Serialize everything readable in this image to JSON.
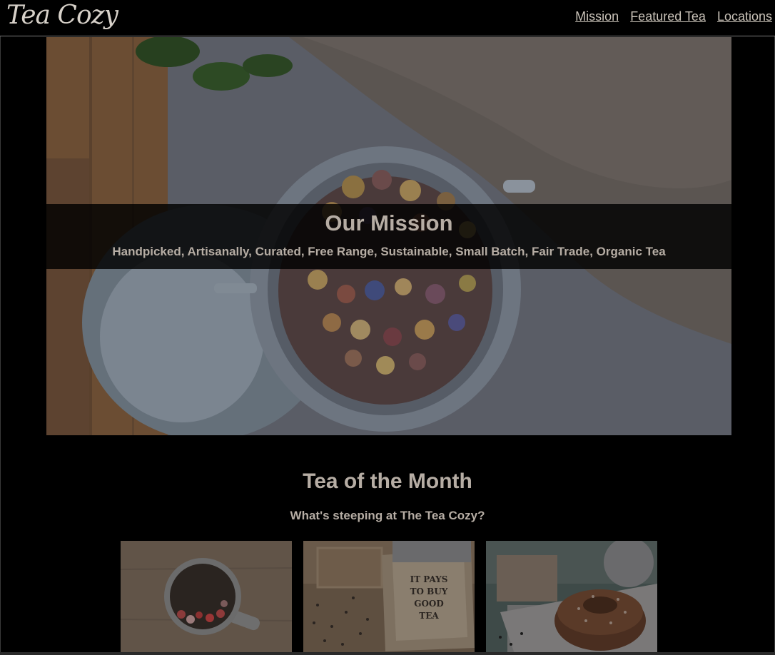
{
  "header": {
    "logo": "Tea Cozy",
    "nav": [
      "Mission",
      "Featured Tea",
      "Locations"
    ]
  },
  "hero": {
    "title": "Our Mission",
    "subtitle": "Handpicked, Artisanally, Curated, Free Range, Sustainable, Small Batch, Fair Trade, Organic Tea",
    "image": "tea-jar-photo"
  },
  "tea_of_month": {
    "title": "Tea of the Month",
    "subtitle": "What's steeping at The Tea Cozy?",
    "thumbnails": [
      {
        "image": "tea-cup-with-berries-photo"
      },
      {
        "image": "tea-box-photo",
        "box_text": [
          "IT PAYS",
          "TO BUY",
          "GOOD",
          "TEA"
        ]
      },
      {
        "image": "donut-pastry-photo"
      }
    ]
  },
  "colors": {
    "background": "#000000",
    "text": "#b6ada4",
    "nav_text": "#c9c2b8",
    "hero_band": "#000000"
  }
}
